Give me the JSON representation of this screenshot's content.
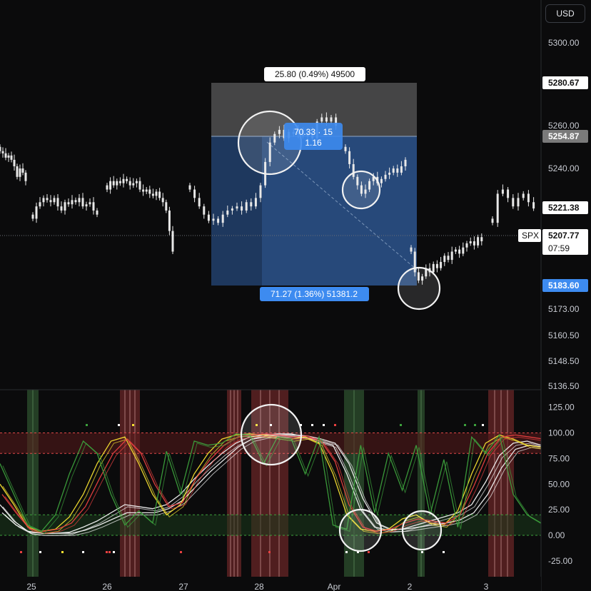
{
  "currency_button": "USD",
  "symbol_tag": "SPX",
  "countdown": "07:59",
  "measure_top_label": "25.80 (0.49%) 49500",
  "measure_bottom_label": "71.27 (1.36%) 51381.2",
  "measure_mid_label_1": "70.33 · 15",
  "measure_mid_label_2": "1.16",
  "price_tags": [
    {
      "text": "5280.67",
      "price": 5280.67,
      "style": "white"
    },
    {
      "text": "5254.87",
      "price": 5254.87,
      "style": "gray"
    },
    {
      "text": "5221.38",
      "price": 5221.38,
      "style": "white"
    },
    {
      "text": "5207.77",
      "price": 5207.77,
      "style": "white"
    },
    {
      "text": "5183.60",
      "price": 5183.6,
      "style": "blue"
    }
  ],
  "colors": {
    "background": "#0b0b0c",
    "candles": "#e8e8e8",
    "measure_blue": "#2f5fa3",
    "measure_gray": "#5a5a5a",
    "label_blue": "#3d8bf0",
    "osc_white": "#f2f2f2",
    "osc_yellow": "#f5e030",
    "osc_red": "#e84040",
    "osc_green": "#3ca03c",
    "zone_red": "#5a1c1c",
    "zone_green": "#1c3a1c",
    "shade_red": "#8a3030",
    "shade_green": "#3a6a3a"
  },
  "chart_data": [
    {
      "type": "candlestick",
      "title": "",
      "xlabel": "",
      "ylabel": "",
      "x_ticks": [
        "25",
        "26",
        "27",
        "28",
        "Apr",
        "2",
        "3"
      ],
      "y_ticks": [
        5300.0,
        5280.0,
        5260.0,
        5240.0,
        5221.38,
        5207.77,
        5183.6,
        5173.0,
        5160.5,
        5148.5,
        5136.5
      ],
      "y_tick_labels": [
        "5300.00",
        "5260.00",
        "5240.00",
        "5173.00",
        "5160.50",
        "5148.50",
        "5136.50"
      ],
      "ylim": [
        5136.5,
        5306
      ],
      "measure_tool": {
        "upper_price": 5280.67,
        "entry_price": 5254.87,
        "lower_price": 5183.6
      },
      "series_segments": [
        {
          "day": "24",
          "points": [
            5248,
            5247,
            5245,
            5246,
            5244,
            5241,
            5236,
            5240,
            5238,
            5234
          ]
        },
        {
          "day": "25",
          "points": [
            5216,
            5222,
            5224,
            5226,
            5225,
            5224,
            5226,
            5222,
            5220,
            5224,
            5223,
            5225,
            5224,
            5226,
            5222,
            5223,
            5224,
            5220,
            5218
          ]
        },
        {
          "day": "26",
          "points": [
            5230,
            5234,
            5232,
            5234,
            5233,
            5235,
            5234,
            5232,
            5233,
            5234,
            5230,
            5229,
            5230,
            5228,
            5227,
            5229,
            5226,
            5224,
            5220,
            5210,
            5200
          ]
        },
        {
          "day": "27",
          "points": [
            5230,
            5226,
            5222,
            5218,
            5215,
            5216,
            5214,
            5218,
            5220,
            5221,
            5222,
            5220,
            5224,
            5222,
            5226,
            5232,
            5243,
            5252,
            5256,
            5258,
            5254,
            5257,
            5256,
            5258,
            5255,
            5257,
            5254,
            5262,
            5264,
            5262,
            5264,
            5260
          ]
        },
        {
          "day": "28",
          "points": [
            5248,
            5242,
            5236,
            5232,
            5228,
            5230,
            5234,
            5236,
            5233,
            5235,
            5237,
            5238,
            5240,
            5238,
            5241,
            5244
          ]
        },
        {
          "day": "Apr-1",
          "points": [
            5200,
            5190,
            5186,
            5188,
            5192,
            5190,
            5194,
            5192,
            5195,
            5198,
            5196,
            5200,
            5201,
            5199,
            5202,
            5204,
            5205,
            5203,
            5207,
            5205
          ]
        },
        {
          "day": "2",
          "points": [
            5214,
            5228,
            5230,
            5226,
            5222,
            5226,
            5228,
            5224,
            5221
          ]
        }
      ]
    },
    {
      "type": "line",
      "title": "",
      "xlabel": "",
      "ylabel": "",
      "x_ticks": [
        "25",
        "26",
        "27",
        "28",
        "Apr",
        "2",
        "3"
      ],
      "y_ticks": [
        125.0,
        100.0,
        75.0,
        50.0,
        25.0,
        0.0,
        -25.0
      ],
      "y_tick_labels": [
        "125.00",
        "100.00",
        "75.00",
        "50.00",
        "25.00",
        "0.00",
        "-25.00"
      ],
      "ylim": [
        -35,
        138
      ],
      "bands": [
        {
          "from": 80,
          "to": 100,
          "color": "red"
        },
        {
          "from": 0,
          "to": 20,
          "color": "green"
        }
      ],
      "series": [
        {
          "color": "white",
          "values": [
            30,
            14,
            4,
            2,
            2,
            3,
            8,
            14,
            22,
            30,
            28,
            26,
            30,
            40,
            55,
            68,
            80,
            90,
            96,
            98,
            99,
            99,
            96,
            92,
            88,
            60,
            25,
            8,
            5,
            6,
            10,
            14,
            18,
            22,
            30,
            52,
            78,
            90,
            92,
            88
          ]
        },
        {
          "color": "white",
          "values": [
            22,
            10,
            3,
            2,
            2,
            2,
            5,
            10,
            16,
            22,
            22,
            22,
            26,
            34,
            48,
            62,
            74,
            86,
            94,
            97,
            98,
            98,
            97,
            94,
            90,
            70,
            36,
            12,
            6,
            6,
            8,
            10,
            12,
            15,
            22,
            40,
            66,
            84,
            88,
            86
          ]
        },
        {
          "color": "yellow",
          "values": [
            50,
            30,
            8,
            4,
            6,
            18,
            40,
            70,
            92,
            96,
            70,
            40,
            20,
            30,
            60,
            80,
            94,
            98,
            99,
            98,
            96,
            94,
            96,
            90,
            60,
            20,
            6,
            4,
            6,
            16,
            20,
            12,
            10,
            24,
            60,
            90,
            98,
            94,
            88,
            86
          ]
        },
        {
          "color": "red",
          "values": [
            40,
            22,
            6,
            4,
            6,
            12,
            28,
            55,
            80,
            94,
            80,
            50,
            28,
            32,
            56,
            74,
            88,
            96,
            98,
            99,
            98,
            96,
            97,
            92,
            72,
            30,
            8,
            4,
            6,
            12,
            16,
            14,
            12,
            20,
            48,
            80,
            96,
            98,
            96,
            94
          ]
        },
        {
          "color": "green",
          "values": [
            70,
            40,
            10,
            4,
            20,
            60,
            92,
            80,
            40,
            10,
            24,
            12,
            82,
            40,
            92,
            88,
            90,
            99,
            98,
            70,
            96,
            94,
            60,
            96,
            10,
            6,
            88,
            22,
            80,
            44,
            88,
            20,
            74,
            8,
            96,
            80,
            98,
            40,
            20,
            12
          ]
        }
      ],
      "shaded_columns": [
        {
          "day": "25",
          "color": "green"
        },
        {
          "day": "26",
          "color": "red"
        },
        {
          "day": "28",
          "color": "red"
        },
        {
          "day": "Apr",
          "color": "green"
        },
        {
          "day": "2",
          "color": "green"
        },
        {
          "day": "3",
          "color": "red"
        }
      ]
    }
  ]
}
